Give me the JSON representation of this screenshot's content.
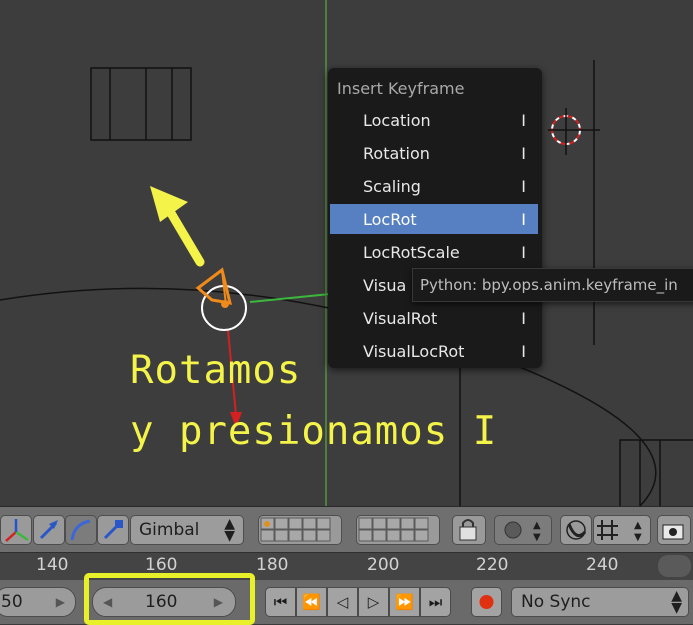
{
  "menu": {
    "title": "Insert Keyframe",
    "items": [
      {
        "label": "Location",
        "hotkey": "I"
      },
      {
        "label": "Rotation",
        "hotkey": "I"
      },
      {
        "label": "Scaling",
        "hotkey": "I"
      },
      {
        "label": "LocRot",
        "hotkey": "I",
        "active": true
      },
      {
        "label": "LocRotScale",
        "hotkey": "I"
      },
      {
        "label": "Visua",
        "hotkey": "I"
      },
      {
        "label": "VisualRot",
        "hotkey": "I"
      },
      {
        "label": "VisualLocRot",
        "hotkey": "I"
      }
    ]
  },
  "tooltip": "Python: bpy.ops.anim.keyframe_in",
  "annotation": {
    "line1": "Rotamos",
    "line2": "y presionamos I",
    "color": "#f3f34a"
  },
  "toolbar": {
    "orientation": "Gimbal"
  },
  "timeline": {
    "ticks": [
      "140",
      "160",
      "180",
      "200",
      "220",
      "240"
    ]
  },
  "controls": {
    "start_frame": "50",
    "current_frame": "160",
    "sync": "No Sync"
  },
  "colors": {
    "menu_highlight": "#5680c2",
    "x_axis": "#d42020",
    "y_axis": "#3cb83c",
    "z_axis": "#6a9be0",
    "selected_object": "#f08a1a"
  }
}
